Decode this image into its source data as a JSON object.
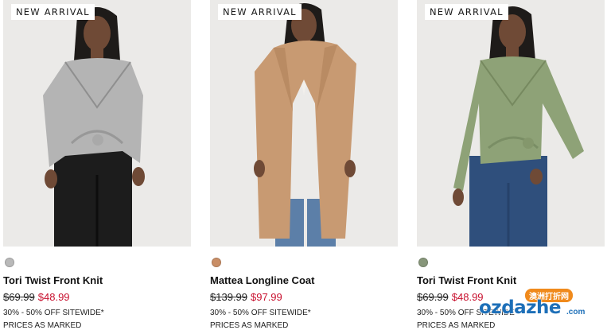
{
  "products": [
    {
      "badge": "NEW ARRIVAL",
      "name": "Tori Twist Front Knit",
      "was_price": "$69.99",
      "sale_price": "$48.99",
      "promo": "30% - 50% OFF SITEWIDE*",
      "price_note": "PRICES AS MARKED",
      "swatch_color": "#b9b9b9",
      "garment_color": "#b4b4b4",
      "bottom_color": "#1c1c1c"
    },
    {
      "badge": "NEW ARRIVAL",
      "name": "Mattea Longline Coat",
      "was_price": "$139.99",
      "sale_price": "$97.99",
      "promo": "30% - 50% OFF SITEWIDE*",
      "price_note": "PRICES AS MARKED",
      "swatch_color": "#c98e66",
      "garment_color": "#c89a72",
      "bottom_color": "#5c7fa8"
    },
    {
      "badge": "NEW ARRIVAL",
      "name": "Tori Twist Front Knit",
      "was_price": "$69.99",
      "sale_price": "$48.99",
      "promo": "30% - 50% OFF SITEWIDE*",
      "price_note": "PRICES AS MARKED",
      "swatch_color": "#87967a",
      "garment_color": "#8ea277",
      "bottom_color": "#2f4f7c"
    }
  ],
  "colors": {
    "sale_red": "#c8102e",
    "photo_bg": "#ebeae8"
  },
  "watermark": {
    "cn_text": "澳洲打折网",
    "main": "ozdazhe",
    "suffix": ".com"
  }
}
